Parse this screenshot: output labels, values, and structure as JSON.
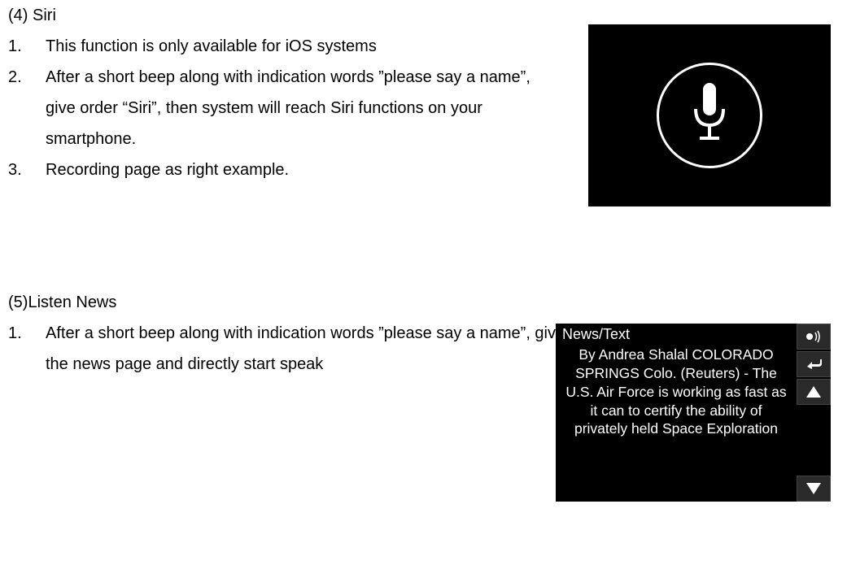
{
  "siri": {
    "heading": "(4) Siri",
    "items": [
      {
        "num": "1.",
        "text": "This function is only available for iOS systems"
      },
      {
        "num": "2.",
        "text": "After a short beep along with indication words ”please say a name”, give order “Siri”, then system will reach Siri functions on your smartphone."
      },
      {
        "num": "3.",
        "text": "Recording page as right example."
      }
    ]
  },
  "news": {
    "heading": "(5)Listen News",
    "items": [
      {
        "num": "1.",
        "text": "After a short beep along with indication words ”please say a name”, give order “Listen News”, you will access the news page and directly start speak"
      }
    ],
    "screen": {
      "title": "News/Text",
      "body": "By Andrea Shalal COLORADO SPRINGS Colo. (Reuters) - The U.S. Air Force is working as fast as it can to certify the ability of privately held Space Exploration"
    }
  }
}
